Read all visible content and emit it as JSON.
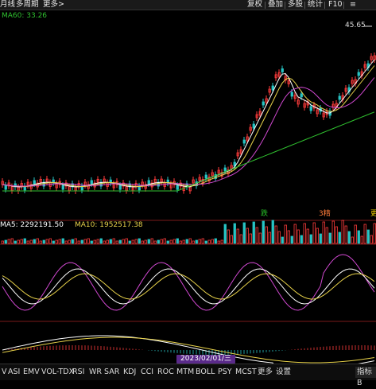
{
  "toolbar": {
    "left": [
      "月线",
      "多周期",
      "更多",
      ">"
    ],
    "right": [
      "复权",
      "叠加",
      "多股",
      "统计",
      "F10",
      "≡"
    ]
  },
  "main_chart": {
    "ma60_label": "MA60: 33.26",
    "price_tag": "45.65",
    "marks": [
      {
        "text": "跌",
        "color": "#27c127"
      },
      {
        "text": "3精",
        "color": "#ff7c3a"
      },
      {
        "text": "更",
        "color": "#e8c800"
      }
    ]
  },
  "volume_chart": {
    "ma5_label": "MA5: 2292191.50",
    "ma10_label": "MA10: 1952517.38"
  },
  "date_chip": "2023/02/01/三",
  "indicator_bar": {
    "items": [
      "V",
      "ASI",
      "EMV",
      "VOL-TDX",
      "RSI",
      "WR",
      "SAR",
      "KDJ",
      "CCI",
      "ROC",
      "MTM",
      "BOLL",
      "PSY",
      "MCST",
      "更多",
      "设置"
    ],
    "right_label": "指标B"
  },
  "colors": {
    "up": "#ff3b3b",
    "down": "#27c4c4",
    "ma60": "#2fc02f",
    "ma5": "#ffffff",
    "ma10": "#e8d24a",
    "ma20": "#d048d0",
    "accent_date": "#5a2a8a"
  },
  "chart_data": {
    "type": "candlestick",
    "ma60_value": 33.26,
    "price_marker": 45.65,
    "volume_ma5": 2292191.5,
    "volume_ma10": 1952517.38,
    "date": "2023/02/01/三"
  }
}
